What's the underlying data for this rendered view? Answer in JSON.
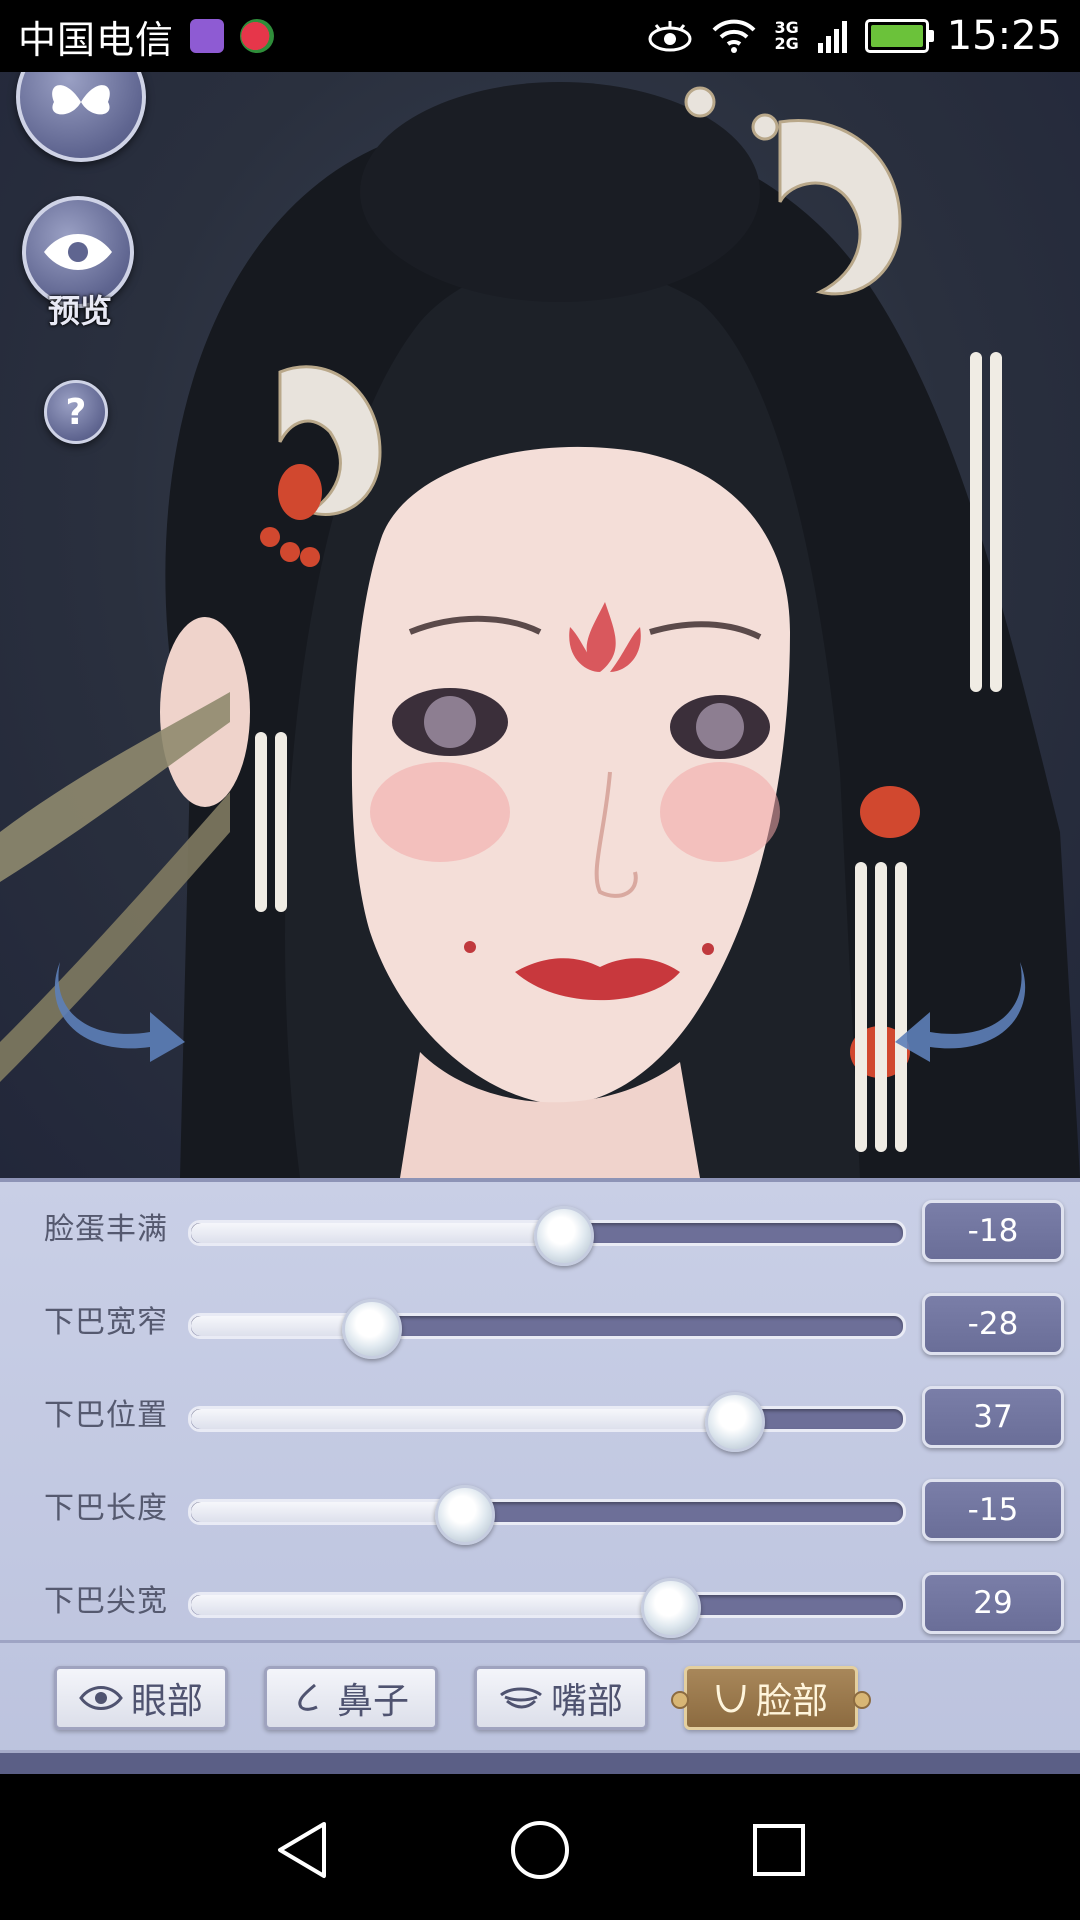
{
  "status_bar": {
    "carrier": "中国电信",
    "network_top": "3G",
    "network_bottom": "2G",
    "time": "15:25"
  },
  "side_buttons": {
    "preview_label": "预览",
    "help_label": "?"
  },
  "sliders": [
    {
      "label": "脸蛋丰满",
      "value": "-18",
      "level": 0.52
    },
    {
      "label": "下巴宽窄",
      "value": "-28",
      "level": 0.25
    },
    {
      "label": "下巴位置",
      "value": "37",
      "level": 0.76
    },
    {
      "label": "下巴长度",
      "value": "-15",
      "level": 0.38
    },
    {
      "label": "下巴尖宽",
      "value": "29",
      "level": 0.67
    }
  ],
  "tabs": [
    {
      "label": "眼部",
      "icon": "eye-icon",
      "active": false
    },
    {
      "label": "鼻子",
      "icon": "nose-icon",
      "active": false
    },
    {
      "label": "嘴部",
      "icon": "mouth-icon",
      "active": false
    },
    {
      "label": "脸部",
      "icon": "face-icon",
      "active": true
    }
  ],
  "colors": {
    "panel": "#c3c9e2",
    "track": "#6d6f98",
    "active_tab": "#9a784b"
  }
}
